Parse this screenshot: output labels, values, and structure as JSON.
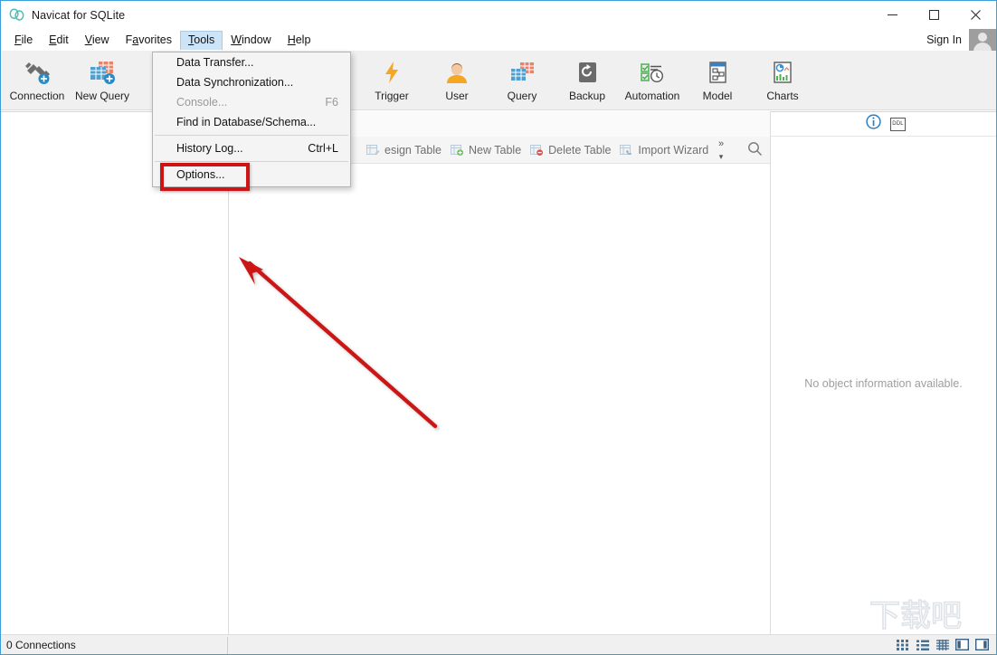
{
  "window": {
    "title": "Navicat for SQLite",
    "app_icon": "navicat-logo-icon",
    "minimize_label": "Minimize",
    "maximize_label": "Maximize",
    "close_label": "Close"
  },
  "menubar": {
    "items": [
      {
        "label": "File",
        "mnemonic": "F",
        "active": false
      },
      {
        "label": "Edit",
        "mnemonic": "E",
        "active": false
      },
      {
        "label": "View",
        "mnemonic": "V",
        "active": false
      },
      {
        "label": "Favorites",
        "mnemonic": "a",
        "active": false
      },
      {
        "label": "Tools",
        "mnemonic": "T",
        "active": true
      },
      {
        "label": "Window",
        "mnemonic": "W",
        "active": false
      },
      {
        "label": "Help",
        "mnemonic": "H",
        "active": false
      }
    ],
    "sign_in": "Sign In"
  },
  "tools_menu": {
    "open": true,
    "items": [
      {
        "label": "Data Transfer...",
        "accel": "",
        "disabled": false,
        "separator_after": false
      },
      {
        "label": "Data Synchronization...",
        "accel": "",
        "disabled": false,
        "separator_after": false
      },
      {
        "label": "Console...",
        "accel": "F6",
        "disabled": true,
        "separator_after": false
      },
      {
        "label": "Find in Database/Schema...",
        "accel": "",
        "disabled": false,
        "separator_after": true
      },
      {
        "label": "History Log...",
        "accel": "Ctrl+L",
        "disabled": false,
        "separator_after": true
      },
      {
        "label": "Options...",
        "accel": "",
        "disabled": false,
        "separator_after": false
      }
    ],
    "highlighted_item": "Options..."
  },
  "toolbar": {
    "left_group": [
      {
        "label": "Connection",
        "icon": "connection-plug-icon"
      },
      {
        "label": "New Query",
        "icon": "new-query-table-icon"
      }
    ],
    "right_group": [
      {
        "label": "Trigger",
        "icon": "trigger-bolt-icon"
      },
      {
        "label": "User",
        "icon": "user-person-icon"
      },
      {
        "label": "Query",
        "icon": "query-table-icon"
      },
      {
        "label": "Backup",
        "icon": "backup-restore-icon"
      },
      {
        "label": "Automation",
        "icon": "automation-checklist-clock-icon"
      },
      {
        "label": "Model",
        "icon": "model-diagram-icon"
      },
      {
        "label": "Charts",
        "icon": "charts-bar-icon"
      }
    ]
  },
  "object_toolbar": {
    "buttons": [
      {
        "label": "esign Table",
        "icon": "design-table-icon"
      },
      {
        "label": "New Table",
        "icon": "new-table-icon"
      },
      {
        "label": "Delete Table",
        "icon": "delete-table-icon"
      },
      {
        "label": "Import Wizard",
        "icon": "import-wizard-icon"
      }
    ],
    "overflow_label": "»",
    "search_icon": "search-icon"
  },
  "info_panel": {
    "info_icon": "info-circle-icon",
    "ddl_icon": "ddl-icon",
    "ddl_label": "DDL",
    "empty_message": "No object information available."
  },
  "statusbar": {
    "connections_text": "0 Connections",
    "view_toggles": [
      {
        "icon": "grid-view-icon",
        "selected": false
      },
      {
        "icon": "list-view-icon",
        "selected": false
      },
      {
        "icon": "detail-view-icon",
        "selected": false
      },
      {
        "icon": "left-pane-toggle-icon",
        "selected": false
      },
      {
        "icon": "right-pane-toggle-icon",
        "selected": false
      }
    ]
  },
  "annotations": {
    "highlight_box_target": "Options...",
    "arrow_color": "#cc1414",
    "highlight_color": "#cc1414",
    "watermark_text": "下载吧"
  },
  "colors": {
    "accent_blue": "#3a9fd8",
    "menu_highlight": "#cde4f7",
    "toolbar_bg": "#f0f0f0",
    "annotation_red": "#cc1414"
  }
}
